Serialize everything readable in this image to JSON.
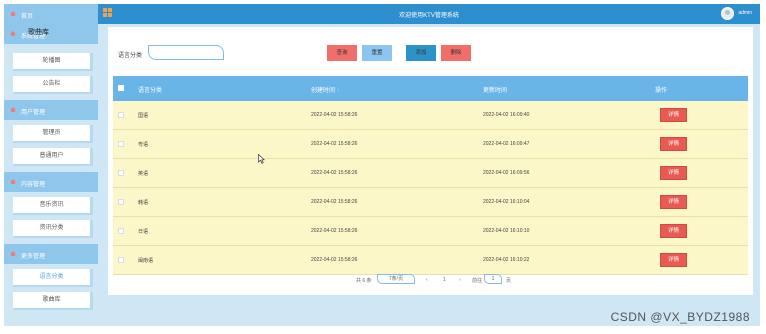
{
  "header": {
    "title": "欢迎使用KTV管理系统",
    "user": "admin"
  },
  "sidebar": {
    "overlap_text": "歌曲库",
    "home_label": "首页",
    "sections": [
      {
        "label": "系统管理",
        "items": [
          "轮播图",
          "公告栏"
        ]
      },
      {
        "label": "用户管理",
        "items": [
          "管理员",
          "普通用户"
        ]
      },
      {
        "label": "内容管理",
        "items": [
          "音乐资讯",
          "资讯分类"
        ]
      },
      {
        "label": "更多管理",
        "items": [
          "语言分类",
          "歌曲库"
        ]
      }
    ],
    "active_item": "语言分类"
  },
  "search": {
    "label": "语言分类",
    "value": "",
    "placeholder": ""
  },
  "buttons": {
    "query": "查询",
    "reset": "重置",
    "add": "添加",
    "delete": "删除"
  },
  "table": {
    "columns": [
      "语言分类",
      "创建时间",
      "更新时间",
      "操作"
    ],
    "sort_indicator": "↕",
    "rows": [
      {
        "name": "国语",
        "created": "2022-04-02 15:58:26",
        "updated": "2022-04-02 16:09:40",
        "action": "详情"
      },
      {
        "name": "粤语",
        "created": "2022-04-02 15:58:26",
        "updated": "2022-04-02 16:09:47",
        "action": "详情"
      },
      {
        "name": "英语",
        "created": "2022-04-02 15:58:26",
        "updated": "2022-04-02 16:09:56",
        "action": "详情"
      },
      {
        "name": "韩语",
        "created": "2022-04-02 15:58:26",
        "updated": "2022-04-02 16:10:04",
        "action": "详情"
      },
      {
        "name": "日语",
        "created": "2022-04-02 15:58:26",
        "updated": "2022-04-02 16:10:10",
        "action": "详情"
      },
      {
        "name": "闽南语",
        "created": "2022-04-02 15:58:26",
        "updated": "2022-04-02 16:10:22",
        "action": "详情"
      }
    ]
  },
  "pagination": {
    "total": "共 6 条",
    "page_size": "7条/页",
    "prev": "‹",
    "page": "1",
    "next": "›",
    "goto": "前往",
    "goto_value": "1",
    "page_suffix": "页"
  },
  "watermark": "CSDN @VX_BYDZ1988",
  "colors": {
    "topbar": "#2e8fcf",
    "table_header": "#69b5e8",
    "row_bg": "#fcf7c9",
    "danger": "#f06f6a",
    "primary": "#2c93c9"
  }
}
